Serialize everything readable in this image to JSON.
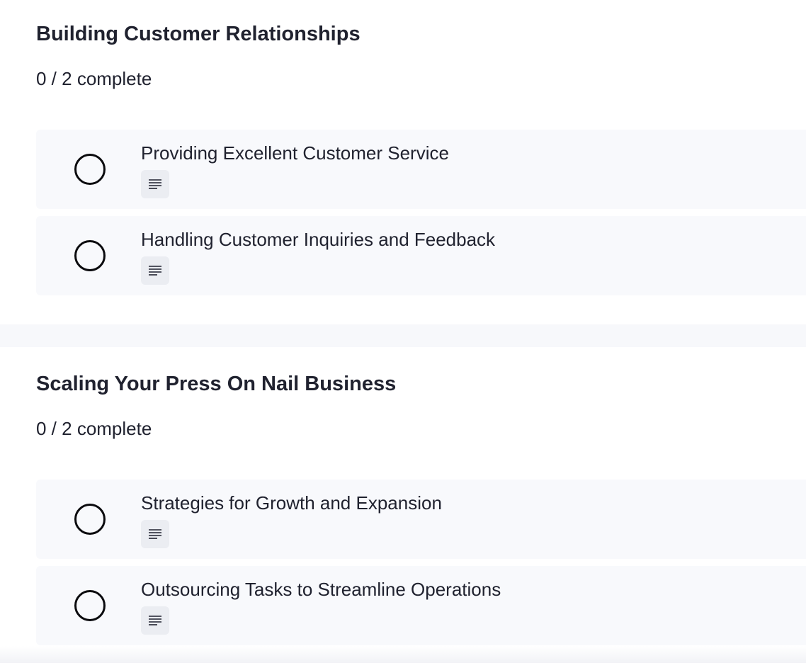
{
  "sections": [
    {
      "title": "Building Customer Relationships",
      "progress": "0 / 2 complete",
      "lessons": [
        {
          "title": "Providing Excellent Customer Service",
          "type_icon": "text-lines-icon",
          "completed": false
        },
        {
          "title": "Handling Customer Inquiries and Feedback",
          "type_icon": "text-lines-icon",
          "completed": false
        }
      ]
    },
    {
      "title": "Scaling Your Press On Nail Business",
      "progress": "0 / 2 complete",
      "lessons": [
        {
          "title": "Strategies for Growth and Expansion",
          "type_icon": "text-lines-icon",
          "completed": false
        },
        {
          "title": "Outsourcing Tasks to Streamline Operations",
          "type_icon": "text-lines-icon",
          "completed": false
        }
      ]
    }
  ],
  "colors": {
    "text": "#20222f",
    "lesson_bg": "#f8f9fc",
    "page_bg": "#f7f8fb",
    "badge_bg": "#ebedf2",
    "circle": "#0b0b0e"
  }
}
